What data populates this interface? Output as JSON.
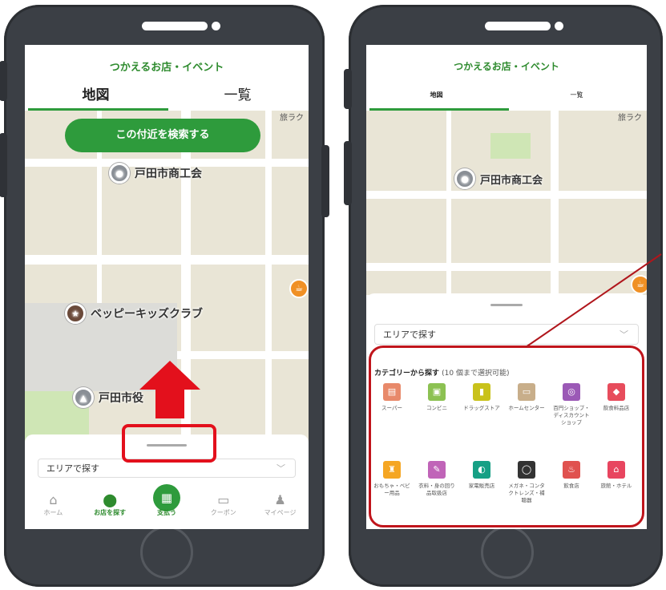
{
  "left_phone": {
    "header_title": "つかえるお店・イベント",
    "tabs": [
      "地図",
      "一覧"
    ],
    "search_button": "この付近を検索する",
    "map_labels": {
      "poi_1": "戸田市商工会",
      "poi_2": "ベッピーキッズクラブ",
      "poi_3": "戸田市役",
      "corner": "旅ラク"
    },
    "area_select": "エリアで探す",
    "nav": [
      {
        "label": "ホーム",
        "icon": "home-icon"
      },
      {
        "label": "お店を探す",
        "icon": "map-pin-icon"
      },
      {
        "label": "支払う",
        "icon": "qr-code-icon"
      },
      {
        "label": "クーポン",
        "icon": "coupon-icon"
      },
      {
        "label": "マイページ",
        "icon": "person-icon"
      }
    ]
  },
  "right_phone": {
    "header_title": "つかえるお店・イベント",
    "tabs": [
      "地図",
      "一覧"
    ],
    "map_labels": {
      "poi_1": "戸田市商工会",
      "corner": "旅ラク"
    },
    "area_select": "エリアで探す",
    "category_title": "カテゴリーから探す",
    "category_note": "(10 個まで選択可能)",
    "categories": [
      {
        "label": "スーパー",
        "color": "#e8896a",
        "icon": "store-icon"
      },
      {
        "label": "コンビニ",
        "color": "#8cc152",
        "icon": "convenience-store-icon"
      },
      {
        "label": "ドラッグストア",
        "color": "#c9c21b",
        "icon": "drugstore-icon"
      },
      {
        "label": "ホームセンター",
        "color": "#c8ae8a",
        "icon": "home-center-icon"
      },
      {
        "label": "百円ショップ・ディスカウントショップ",
        "color": "#9b59b6",
        "icon": "hundred-yen-icon"
      },
      {
        "label": "飲食料品店",
        "color": "#e74c5c",
        "icon": "food-store-icon"
      },
      {
        "label": "おもちゃ・ベビー用品",
        "color": "#f5a623",
        "icon": "toy-icon"
      },
      {
        "label": "衣料・身の回り品取扱店",
        "color": "#c064b8",
        "icon": "clothing-icon"
      },
      {
        "label": "家電販売店",
        "color": "#16a085",
        "icon": "appliance-icon"
      },
      {
        "label": "メガネ・コンタクトレンズ・補聴器",
        "color": "#333333",
        "icon": "glasses-icon"
      },
      {
        "label": "飲食店",
        "color": "#e0524f",
        "icon": "restaurant-icon"
      },
      {
        "label": "旅館・ホテル",
        "color": "#e8455f",
        "icon": "hotel-icon"
      }
    ]
  },
  "colors": {
    "brand_green": "#2e9b3c",
    "annotation_red": "#e3101c",
    "phone_body": "#3b3f45"
  }
}
